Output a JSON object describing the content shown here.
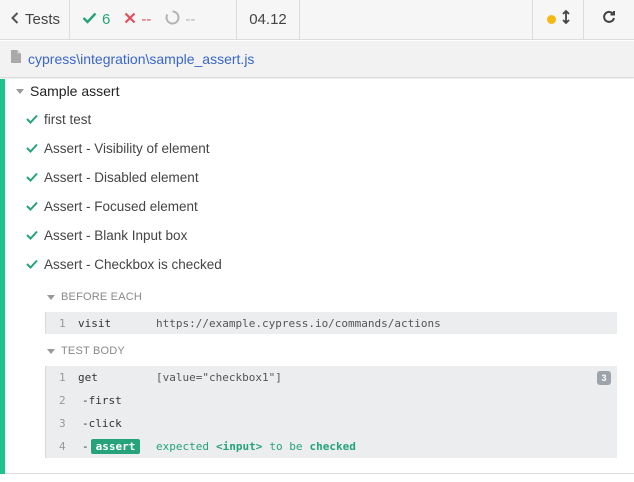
{
  "header": {
    "tests_label": "Tests",
    "passed": "6",
    "failed": "--",
    "pending": "--",
    "duration": "04.12"
  },
  "file": {
    "path": "cypress\\integration\\sample_assert.js"
  },
  "suite": {
    "title": "Sample assert",
    "tests": [
      "first test",
      "Assert - Visibility of element",
      "Assert - Disabled element",
      "Assert - Focused element",
      "Assert - Blank Input box",
      "Assert - Checkbox is checked"
    ]
  },
  "before_each": {
    "label": "BEFORE EACH",
    "commands": [
      {
        "num": "1",
        "name": "visit",
        "message": "https://example.cypress.io/commands/actions"
      }
    ]
  },
  "test_body": {
    "label": "TEST BODY",
    "badge": "3",
    "commands": [
      {
        "num": "1",
        "name": "get",
        "message": "[value=\"checkbox1\"]"
      },
      {
        "num": "2",
        "name": "-first",
        "message": ""
      },
      {
        "num": "3",
        "name": "-click",
        "message": ""
      },
      {
        "num": "4",
        "prefix": "-",
        "name": "assert",
        "msg_a": "expected",
        "msg_b": "<input>",
        "msg_c": "to be",
        "msg_d": "checked"
      }
    ]
  },
  "colors": {
    "pass": "#26a37a",
    "fail": "#e0505a",
    "running": "#f5b914",
    "link": "#3a66c8",
    "accent_bar": "#1ec28a"
  }
}
